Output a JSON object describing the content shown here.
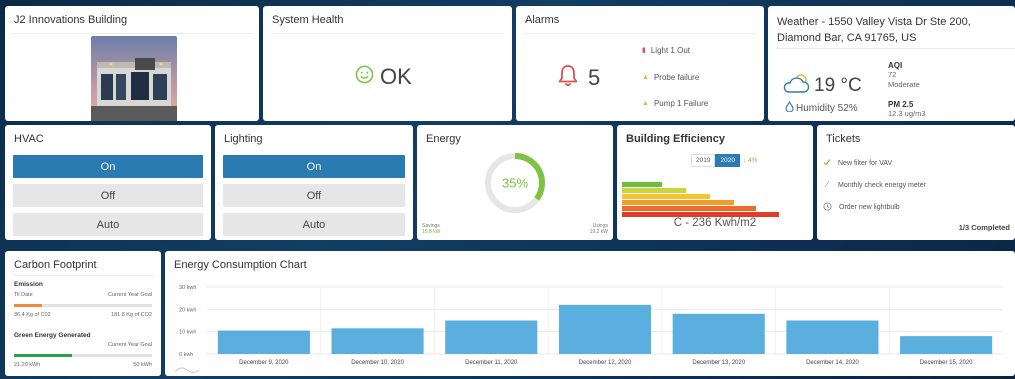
{
  "building": {
    "title": "J2 Innovations Building"
  },
  "system_health": {
    "title": "System Health",
    "status": "OK"
  },
  "alarms": {
    "title": "Alarms",
    "count": "5",
    "items": [
      {
        "label": "Light 1 Out",
        "color": "#d9534f",
        "marker": "▮"
      },
      {
        "label": "Probe failure",
        "color": "#f0ad4e",
        "marker": "▲"
      },
      {
        "label": "Pump 1 Failure",
        "color": "#f0ad4e",
        "marker": "▲"
      }
    ]
  },
  "weather": {
    "title": "Weather - 1550 Valley Vista Dr Ste 200, Diamond Bar, CA 91765, US",
    "temperature": "19 °C",
    "humidity": "Humidity 52%",
    "aqi_label": "AQI",
    "aqi_value": "72",
    "aqi_status": "Moderate",
    "pm_label": "PM 2.5",
    "pm_value": "12.3 ug/m3"
  },
  "hvac": {
    "title": "HVAC",
    "options": [
      "On",
      "Off",
      "Auto"
    ],
    "active": "On"
  },
  "lighting": {
    "title": "Lighting",
    "options": [
      "On",
      "Off",
      "Auto"
    ],
    "active": "On"
  },
  "energy": {
    "title": "Energy",
    "percent": 35,
    "percent_label": "35%",
    "savings_label": "Savings",
    "savings_value": "10.8 kW",
    "usings_label": "Usings",
    "usings_value": "19.2 kW",
    "accent": "#7dc242"
  },
  "efficiency": {
    "title": "Building Efficiency",
    "years": [
      "2019",
      "2020"
    ],
    "active_year": "2020",
    "delta": "↓ 4%",
    "rating": "C - 236 Kwh/m2",
    "bars": [
      {
        "color": "#6cbf3c",
        "fill": 0.25
      },
      {
        "color": "#c8d63a",
        "fill": 0.4
      },
      {
        "color": "#f2c430",
        "fill": 0.55
      },
      {
        "color": "#f39c2c",
        "fill": 0.7
      },
      {
        "color": "#ee6a2b",
        "fill": 0.84
      },
      {
        "color": "#e23b26",
        "fill": 0.98
      }
    ]
  },
  "tickets": {
    "title": "Tickets",
    "items": [
      {
        "label": "New filter for VAV",
        "icon": "check-icon",
        "done": true
      },
      {
        "label": "Monthly check energy meter",
        "icon": "pending-icon",
        "done": false
      },
      {
        "label": "Order new lightbulb",
        "icon": "clock-icon",
        "done": false
      }
    ],
    "summary": "1/3 Completed"
  },
  "carbon": {
    "title": "Carbon Footprint",
    "emission_label": "Emission",
    "emission_left_label": "Til Date",
    "emission_right_label": "Current Year Goal",
    "emission_left_value": "36.4 Kg of C02",
    "emission_right_value": "181.8 Kg of CO2",
    "emission_fraction": 0.2,
    "emission_color": "#f08a3c",
    "green_label": "Green Energy Generated",
    "green_right_label": "Current Year Goal",
    "green_left_value": "21.20 kWh",
    "green_right_value": "50 kWh",
    "green_fraction": 0.42,
    "green_color": "#2e9e4a"
  },
  "chart_data": {
    "type": "bar",
    "title": "Energy Consumption Chart",
    "categories": [
      "December 9, 2020",
      "December 10, 2020",
      "December 11, 2020",
      "December 12, 2020",
      "December 13, 2020",
      "December 14, 2020",
      "December 15, 2020"
    ],
    "values": [
      10.5,
      11.5,
      15,
      22,
      18,
      15,
      8
    ],
    "y_ticks": [
      "0 kwh",
      "10 kwh",
      "20 kwh",
      "30 kwh"
    ],
    "ylim": [
      0,
      30
    ],
    "bar_color": "#5aafde",
    "grid": true
  }
}
